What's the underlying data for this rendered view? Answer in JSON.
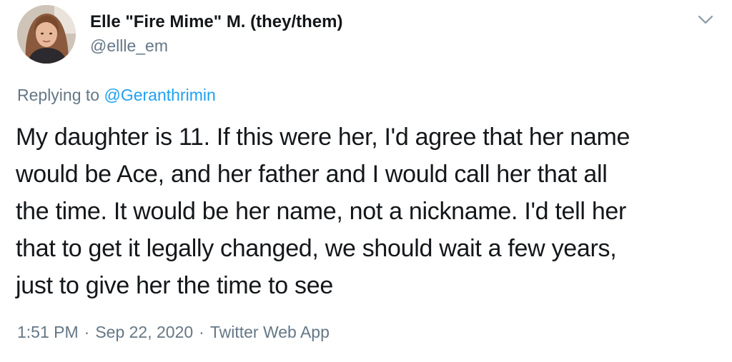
{
  "author": {
    "display_name": "Elle \"Fire Mime\" M. (they/them)",
    "handle": "@ellle_em",
    "avatar_icon": "profile-photo"
  },
  "reply": {
    "prefix": "Replying to ",
    "mention": "@Geranthrimin"
  },
  "body": {
    "lines": [
      "My daughter is 11. If this were her, I'd agree that her name",
      "would be Ace, and her father and I would call her that all",
      "the time. It would be her name, not a nickname. I'd tell her",
      "that to get it legally changed, we should wait a few years,",
      "just to give her the time to see"
    ]
  },
  "meta": {
    "time": "1:51 PM",
    "separator": "·",
    "date": "Sep 22, 2020",
    "source": "Twitter Web App"
  },
  "menu": {
    "icon": "chevron-down-icon"
  },
  "colors": {
    "text": "#14171a",
    "secondary": "#657786",
    "link": "#1da1f2"
  }
}
